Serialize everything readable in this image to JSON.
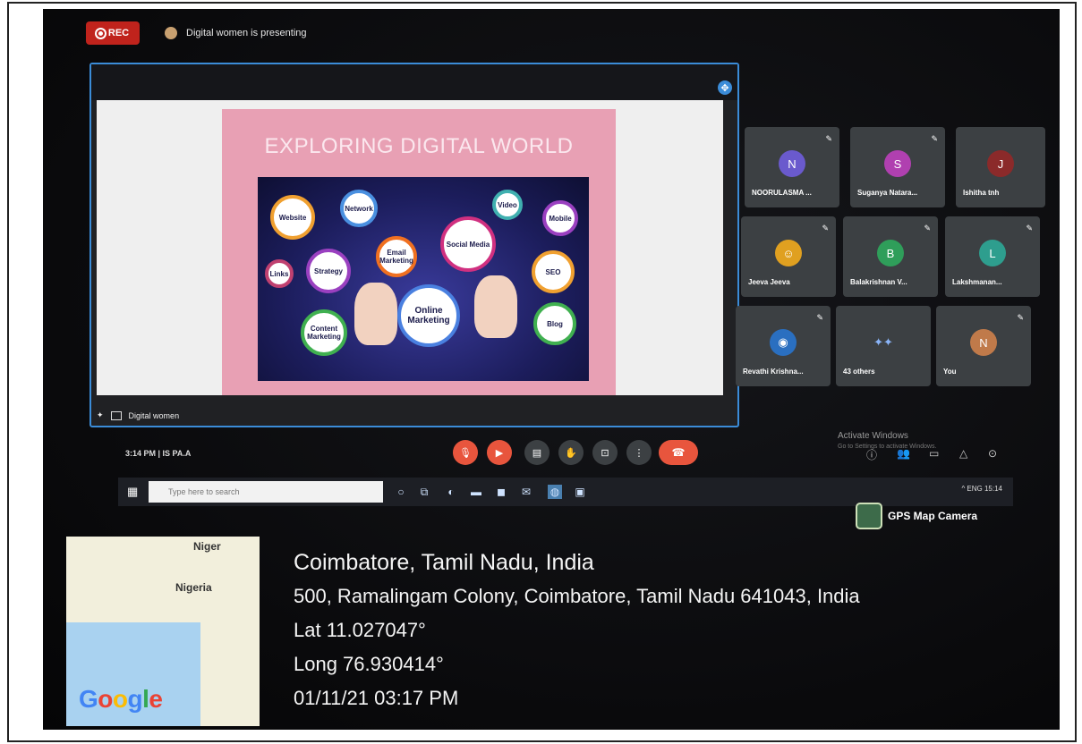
{
  "meet": {
    "rec_label": "REC",
    "presenting_text": "Digital women is presenting",
    "time_label": "3:14 PM | IS PA.A",
    "tile_label": "Digital women",
    "activate_title": "Activate Windows",
    "activate_sub": "Go to Settings to activate Windows."
  },
  "slide": {
    "title": "EXPLORING DIGITAL WORLD",
    "gears": [
      "Website",
      "Network",
      "Strategy",
      "Email Marketing",
      "Social Media",
      "SEO",
      "Online Marketing",
      "Blog",
      "Content Marketing",
      "Mobile",
      "Video",
      "Links"
    ]
  },
  "participants": [
    {
      "initial": "N",
      "name": "NOORULASMA ...",
      "color": "#6a5acd"
    },
    {
      "initial": "S",
      "name": "Suganya Natara...",
      "color": "#b040b0"
    },
    {
      "initial": "J",
      "name": "Ishitha tnh",
      "color": "#8b2a2a"
    },
    {
      "initial": "",
      "name": "Jeeva Jeeva",
      "color": "#e0a020"
    },
    {
      "initial": "B",
      "name": "Balakrishnan V...",
      "color": "#2f9e5a"
    },
    {
      "initial": "L",
      "name": "Lakshmanan...",
      "color": "#2e9e8e"
    },
    {
      "initial": "",
      "name": "Revathi Krishna...",
      "color": "#2a6fc0"
    },
    {
      "initial": "",
      "name": "43 others",
      "color": "#3c4043"
    },
    {
      "initial": "N",
      "name": "You",
      "color": "#c07a4a"
    }
  ],
  "taskbar": {
    "search_placeholder": "Type here to search",
    "tray_text": "^ ENG 15:14"
  },
  "gps": {
    "badge": "GPS Map Camera",
    "map_labels": [
      "Niger",
      "Nigeria"
    ],
    "google": "Google",
    "city": "Coimbatore, Tamil Nadu, India",
    "address": "500, Ramalingam Colony, Coimbatore, Tamil Nadu 641043, India",
    "lat": "Lat 11.027047°",
    "long": "Long 76.930414°",
    "datetime": "01/11/21 03:17 PM"
  },
  "colors": {
    "rec": "#c0231c",
    "tile_border": "#3b8cd8",
    "end_call": "#e8553d",
    "mute_button": "#e8553d"
  }
}
